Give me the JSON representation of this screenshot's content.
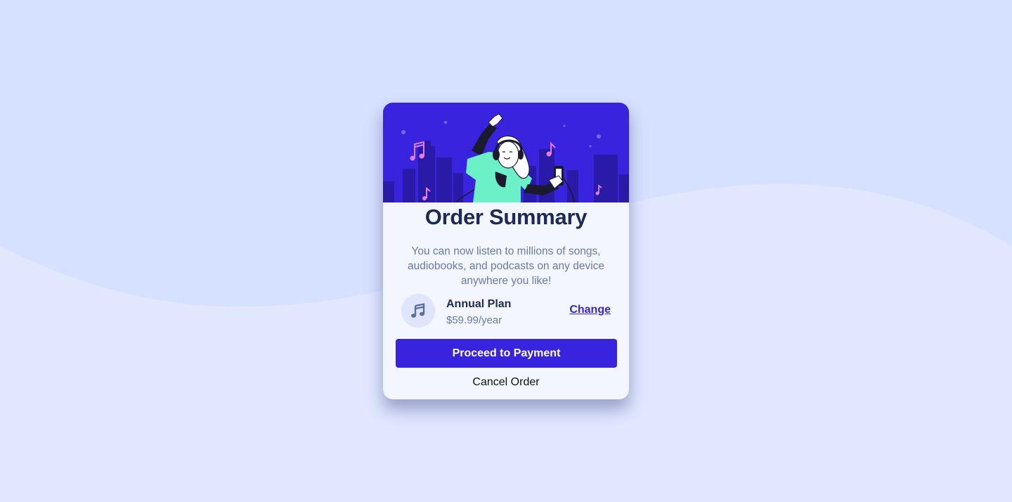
{
  "colors": {
    "page_background": "#e0e7ff",
    "wave": "#d6e0ff",
    "card_background": "#f3f6fe",
    "hero_background": "#3823de",
    "accent": "#3823de",
    "title": "#1e2a55",
    "muted_text": "#6a7aa2"
  },
  "card": {
    "hero_image": "music-listener-illustration",
    "title": "Order Summary",
    "description": "You can now listen to millions of songs, audiobooks, and podcasts on any device anywhere you like!",
    "plan": {
      "icon": "music-note-icon",
      "name": "Annual Plan",
      "price": "$59.99/year",
      "change_label": "Change"
    },
    "primary_button_label": "Proceed to Payment",
    "secondary_button_label": "Cancel Order"
  }
}
